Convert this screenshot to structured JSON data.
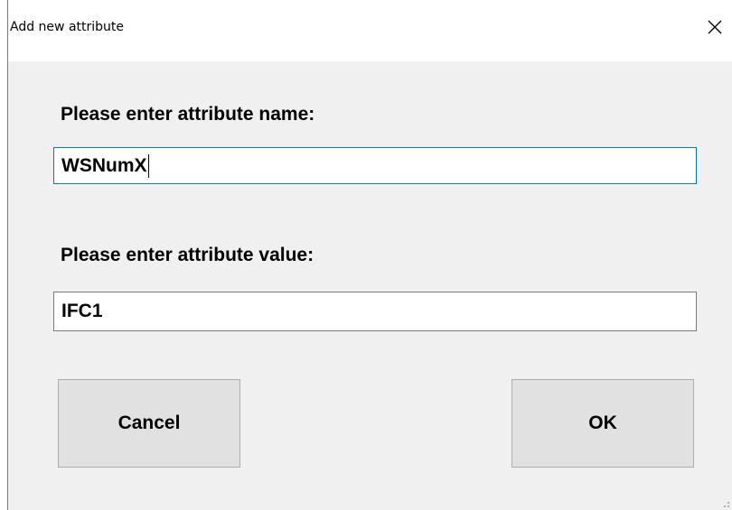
{
  "window": {
    "title": "Add new attribute",
    "close_icon": "close-icon"
  },
  "form": {
    "name_label": "Please enter attribute name:",
    "name_value": "WSNumX",
    "value_label": "Please enter attribute value:",
    "value_value": "IFC1"
  },
  "buttons": {
    "cancel_label": "Cancel",
    "ok_label": "OK"
  },
  "colors": {
    "dialog_background": "#f0f0f0",
    "title_background": "#ffffff",
    "focus_border": "#0078d7",
    "button_face": "#e1e1e1"
  }
}
